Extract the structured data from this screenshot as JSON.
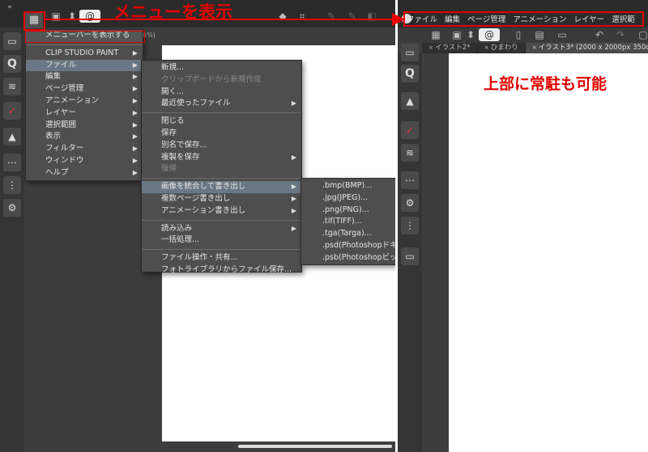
{
  "annotations": {
    "menu_callout": "メニューを表示",
    "pinned_callout": "上部に常駐も可能"
  },
  "left": {
    "toggle_label": "メニューバーを表示する",
    "zoom_fragment": "6%)",
    "main_menu": [
      {
        "label": "CLIP STUDIO PAINT",
        "submenu": true
      },
      {
        "label": "ファイル",
        "submenu": true,
        "selected": true
      },
      {
        "label": "編集",
        "submenu": true
      },
      {
        "label": "ページ管理",
        "submenu": true
      },
      {
        "label": "アニメーション",
        "submenu": true
      },
      {
        "label": "レイヤー",
        "submenu": true
      },
      {
        "label": "選択範囲",
        "submenu": true
      },
      {
        "label": "表示",
        "submenu": true
      },
      {
        "label": "フィルター",
        "submenu": true
      },
      {
        "label": "ウィンドウ",
        "submenu": true
      },
      {
        "label": "ヘルプ",
        "submenu": true
      }
    ],
    "file_menu": {
      "group1": [
        {
          "label": "新規..."
        },
        {
          "label": "クリップボードから新規作成",
          "disabled": true
        },
        {
          "label": "開く..."
        },
        {
          "label": "最近使ったファイル",
          "submenu": true
        }
      ],
      "group2": [
        {
          "label": "閉じる"
        },
        {
          "label": "保存"
        },
        {
          "label": "別名で保存..."
        },
        {
          "label": "複製を保存",
          "submenu": true
        },
        {
          "label": "復帰",
          "disabled": true
        }
      ],
      "group3": [
        {
          "label": "画像を統合して書き出し",
          "submenu": true,
          "selected": true
        },
        {
          "label": "複数ページ書き出し",
          "submenu": true
        },
        {
          "label": "アニメーション書き出し",
          "submenu": true
        }
      ],
      "group4": [
        {
          "label": "読み込み",
          "submenu": true
        },
        {
          "label": "一括処理..."
        }
      ],
      "group5": [
        {
          "label": "ファイル操作・共有..."
        },
        {
          "label": "フォトライブラリからファイル保存..."
        }
      ]
    },
    "export_menu": [
      {
        "label": ".bmp(BMP)..."
      },
      {
        "label": ".jpg(JPEG)..."
      },
      {
        "label": ".png(PNG)..."
      },
      {
        "label": ".tif(TIFF)..."
      },
      {
        "label": ".tga(Targa)..."
      },
      {
        "label": ".psd(Photoshopドキュ"
      },
      {
        "label": ".psb(Photoshopビック"
      }
    ]
  },
  "right": {
    "menubar": [
      "ファイル",
      "編集",
      "ページ管理",
      "アニメーション",
      "レイヤー",
      "選択範"
    ],
    "tabs": [
      {
        "label": "イラスト2*",
        "active": false
      },
      {
        "label": "ひまわり",
        "active": false
      },
      {
        "label": "イラスト3* (2000 x 2000px 350dpi 1",
        "active": true
      }
    ]
  },
  "colors": {
    "annotation_red": "#e40000",
    "menu_selection": "#6b7784",
    "panel_bg": "#3d3d3d"
  }
}
